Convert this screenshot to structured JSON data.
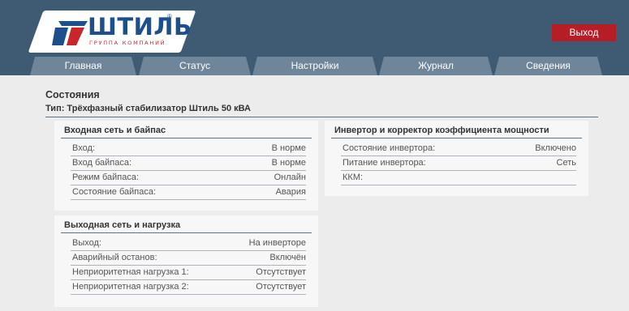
{
  "brand": {
    "name": "ШТИЛЬ",
    "registered": "®",
    "tagline": "ГРУППА КОМПАНИЙ",
    "colors": {
      "blue": "#1d4f8c",
      "red": "#c8252c"
    }
  },
  "header": {
    "logout_label": "Выход",
    "colors": {
      "bar": "#3f5a73",
      "logout": "#b71d27",
      "tab": "#6f8599"
    }
  },
  "nav": {
    "tabs": [
      {
        "label": "Главная"
      },
      {
        "label": "Статус"
      },
      {
        "label": "Настройки"
      },
      {
        "label": "Журнал"
      },
      {
        "label": "Сведения"
      }
    ]
  },
  "main": {
    "title": "Состояния",
    "subtitle": "Тип: Трёхфазный стабилизатор Штиль 50 кВА",
    "panels": [
      {
        "title": "Входная сеть и байпас",
        "rows": [
          {
            "label": "Вход:",
            "value": "В норме"
          },
          {
            "label": "Вход байпаса:",
            "value": "В норме"
          },
          {
            "label": "Режим байпаса:",
            "value": "Онлайн"
          },
          {
            "label": "Состояние байпаса:",
            "value": "Авария"
          }
        ]
      },
      {
        "title": "Инвертор и корректор коэффициента мощности",
        "rows": [
          {
            "label": "Состояние инвертора:",
            "value": "Включено"
          },
          {
            "label": "Питание инвертора:",
            "value": "Сеть"
          },
          {
            "label": "ККМ:",
            "value": ""
          }
        ]
      },
      {
        "title": "Выходная сеть и нагрузка",
        "rows": [
          {
            "label": "Выход:",
            "value": "На инверторе"
          },
          {
            "label": "Аварийный останов:",
            "value": "Включён"
          },
          {
            "label": "Неприоритетная нагрузка 1:",
            "value": "Отсутствует"
          },
          {
            "label": "Неприоритетная нагрузка 2:",
            "value": "Отсутствует"
          }
        ]
      }
    ]
  }
}
